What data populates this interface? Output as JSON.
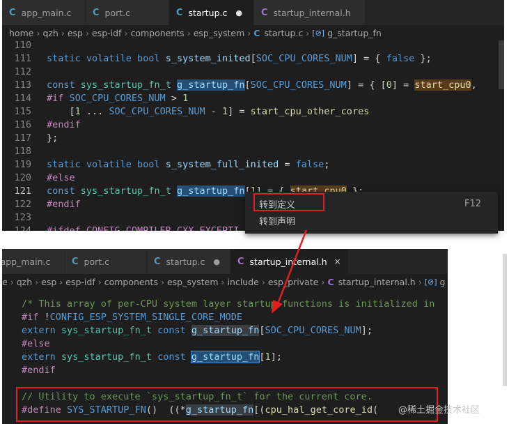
{
  "top_editor": {
    "tabs": [
      {
        "icon": "C",
        "name": "app_main.c"
      },
      {
        "icon": "C",
        "name": "port.c"
      },
      {
        "icon": "C",
        "name": "startup.c",
        "modified": "●"
      },
      {
        "icon": "C",
        "name": "startup_internal.h"
      }
    ],
    "breadcrumb": [
      "home",
      "qzh",
      "esp",
      "esp-idf",
      "components",
      "esp_system",
      "startup.c",
      "g_startup_fn"
    ],
    "line_numbers": [
      "110",
      "111",
      "112",
      "113",
      "114",
      "115",
      "116",
      "117",
      "118",
      "119",
      "120",
      "121",
      "122",
      "123",
      "124"
    ],
    "code": {
      "l111": {
        "a": "static volatile bool ",
        "b": "s_system_inited",
        "c": "[",
        "d": "SOC_CPU_CORES_NUM",
        "e": "] = { ",
        "f": "false",
        " g": " };"
      },
      "l113": {
        "a": "const ",
        "b": "sys_startup_fn_t ",
        "c": "g_startup_fn",
        "d": "[",
        "e": "SOC_CPU_CORES_NUM",
        "f": "] = { [",
        "g": "0",
        "h": "] = ",
        "i": "start_cpu0",
        ",": ","
      },
      "l114": {
        "a": "#if ",
        "b": "SOC_CPU_CORES_NUM",
        " c": " > ",
        "d": "1"
      },
      "l115": {
        "a": "    [",
        "b": "1",
        " c": " ... ",
        "d": "SOC_CPU_CORES_NUM",
        "e": " - ",
        "f": "1",
        "g": "] = ",
        "h": "start_cpu_other_cores"
      },
      "l116": "#endif",
      "l117": "};",
      "l119": {
        "a": "static volatile bool ",
        "b": "s_system_full_inited",
        "c": " = ",
        "d": "false",
        ";": ";"
      },
      "l120": "#else",
      "l121": {
        "a": "const ",
        "b": "sys_startup_fn_t ",
        "c": "g_startup_fn",
        "d": "[",
        "e": "1",
        "f": "] = { ",
        "g": "start_cpu0",
        "h": " };"
      },
      "l122": "#endif",
      "l124": "#ifdef CONFIG_COMPILER_CXX_EXCEPTI"
    },
    "context_menu": [
      {
        "label": "转到定义",
        "shortcut": "F12"
      },
      {
        "label": "转到声明",
        "shortcut": ""
      }
    ]
  },
  "bottom_editor": {
    "tabs": [
      {
        "icon": "C",
        "name": "app_main.c"
      },
      {
        "icon": "C",
        "name": "port.c"
      },
      {
        "icon": "C",
        "name": "startup.c",
        "modified": "●"
      },
      {
        "icon": "C",
        "name": "startup_internal.h",
        "close": "×"
      }
    ],
    "breadcrumb": [
      "e",
      "qzh",
      "esp",
      "esp-idf",
      "components",
      "esp_system",
      "include",
      "esp_private",
      "startup_internal.h",
      "g"
    ],
    "code": {
      "l1": "/* This array of per-CPU system layer startup functions is initialized in",
      "l2": {
        "a": "#if ",
        "b": "!",
        "c": "CONFIG_ESP_SYSTEM_SINGLE_CORE_MODE"
      },
      "l3": {
        "a": "extern ",
        "b": "sys_startup_fn_t ",
        "c": "const ",
        "d": "g_startup_fn",
        "e": "[",
        "f": "SOC_CPU_CORES_NUM",
        "g": "];"
      },
      "l4": "#else",
      "l5": {
        "a": "extern ",
        "b": "sys_startup_fn_t ",
        "c": "const ",
        "d": "g_startup_fn",
        "e": "[",
        "f": "1",
        "g": "];"
      },
      "l6": "#endif",
      "l8": "// Utility to execute `sys_startup_fn_t` for the current core.",
      "l9": {
        "a": "#define ",
        "b": "SYS_STARTUP_FN",
        "c": "()  ((*",
        "d": "g_startup_fn",
        "e": "[(",
        "f": "cpu_hal_get_core_id",
        "g": "("
      }
    }
  },
  "watermark": "@稀土掘金技术社区",
  "colors": {
    "annotation_red": "#e02020",
    "editor_bg": "#1e1e1e",
    "selection": "#264f78"
  }
}
